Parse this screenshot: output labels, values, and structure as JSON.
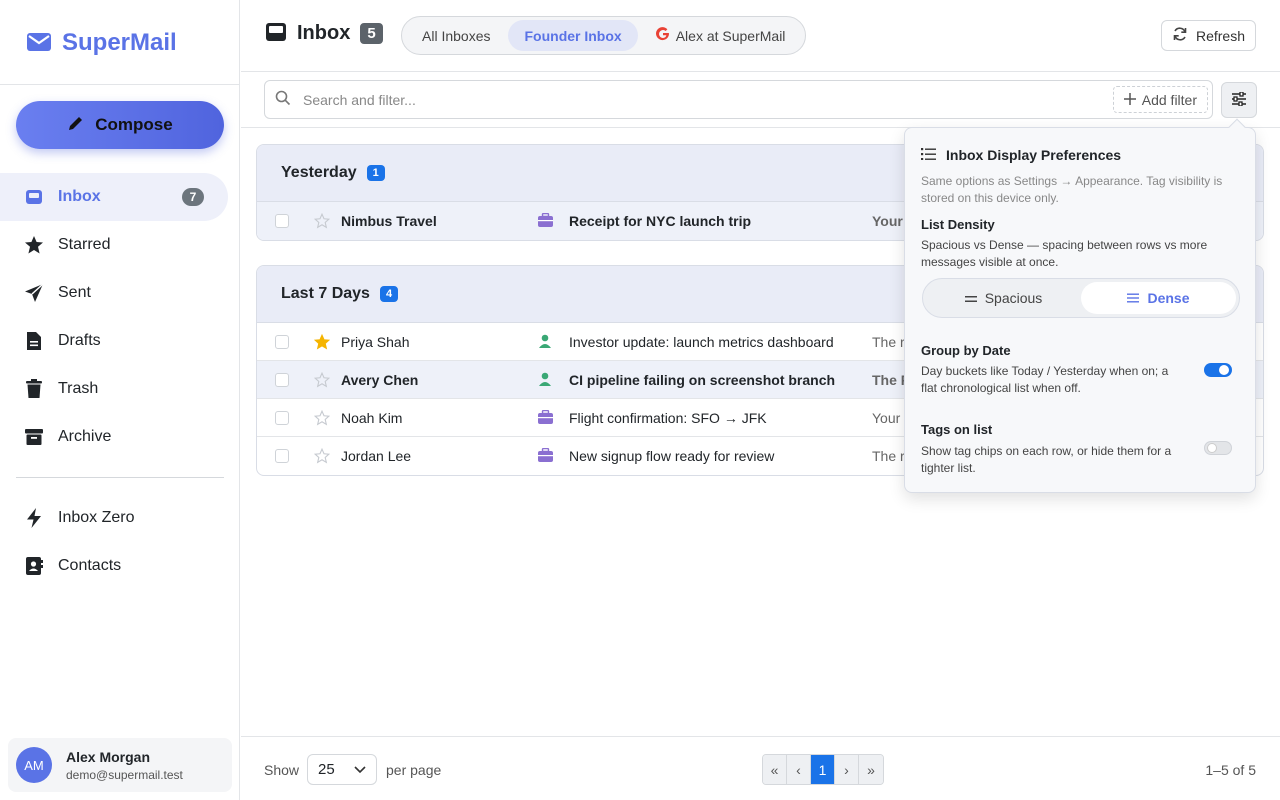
{
  "app": {
    "name": "SuperMail"
  },
  "compose": {
    "label": "Compose"
  },
  "nav": {
    "items": [
      {
        "label": "Inbox",
        "badge": "7",
        "icon": "inbox-icon"
      },
      {
        "label": "Starred",
        "icon": "star-icon"
      },
      {
        "label": "Sent",
        "icon": "send-icon"
      },
      {
        "label": "Drafts",
        "icon": "draft-icon"
      },
      {
        "label": "Trash",
        "icon": "trash-icon"
      },
      {
        "label": "Archive",
        "icon": "archive-icon"
      }
    ],
    "secondary": [
      {
        "label": "Inbox Zero",
        "icon": "bolt-icon"
      },
      {
        "label": "Contacts",
        "icon": "contacts-icon"
      }
    ]
  },
  "user": {
    "initials": "AM",
    "name": "Alex Morgan",
    "email": "demo@supermail.test"
  },
  "header": {
    "title": "Inbox",
    "count": "5",
    "tabs": [
      "All Inboxes",
      "Founder Inbox",
      "Alex at SuperMail"
    ],
    "refresh": "Refresh"
  },
  "search": {
    "placeholder": "Search and filter...",
    "add_filter": "Add filter"
  },
  "groups": [
    {
      "title": "Yesterday",
      "count": "1",
      "rows": [
        {
          "sender": "Nimbus Travel",
          "subject": "Receipt for NYC launch trip",
          "preview": "Your",
          "starred": false,
          "unread": true,
          "tag": "briefcase-icon"
        }
      ]
    },
    {
      "title": "Last 7 Days",
      "count": "4",
      "rows": [
        {
          "sender": "Priya Shah",
          "subject": "Investor update: launch metrics dashboard",
          "preview": "The r",
          "starred": true,
          "unread": false,
          "tag": "person-icon"
        },
        {
          "sender": "Avery Chen",
          "subject": "CI pipeline failing on screenshot branch",
          "preview": "The P",
          "starred": false,
          "unread": true,
          "tag": "person-icon"
        },
        {
          "sender": "Noah Kim",
          "subject": "Flight confirmation: SFO → JFK",
          "preview": "Your",
          "starred": false,
          "unread": false,
          "tag": "briefcase-icon"
        },
        {
          "sender": "Jordan Lee",
          "subject": "New signup flow ready for review",
          "preview": "The r",
          "starred": false,
          "unread": false,
          "tag": "briefcase-icon"
        }
      ]
    }
  ],
  "prefs": {
    "title": "Inbox Display Preferences",
    "desc": "Same options as Settings → Appearance. Tag visibility is stored on this device only.",
    "density": {
      "title": "List Density",
      "desc": "Spacious vs Dense — spacing between rows vs more messages visible at once.",
      "options": [
        "Spacious",
        "Dense"
      ],
      "selected": "Dense"
    },
    "group_by_date": {
      "title": "Group by Date",
      "desc": "Day buckets like Today / Yesterday when on; a flat chronological list when off.",
      "enabled": true
    },
    "tags_on_list": {
      "title": "Tags on list",
      "desc": "Show tag chips on each row, or hide them for a tighter list.",
      "enabled": false
    }
  },
  "footer": {
    "show": "Show",
    "per_page_value": "25",
    "per_page_label": "per page",
    "pager": [
      "«",
      "‹",
      "1",
      "›",
      "»"
    ],
    "current_page": "1",
    "range": "1–5 of 5"
  },
  "colors": {
    "accent": "#5a73e6",
    "blue": "#1a73e8",
    "tag_purple": "#8a6fd1",
    "tag_green": "#3aa875",
    "star": "#f5b400"
  }
}
